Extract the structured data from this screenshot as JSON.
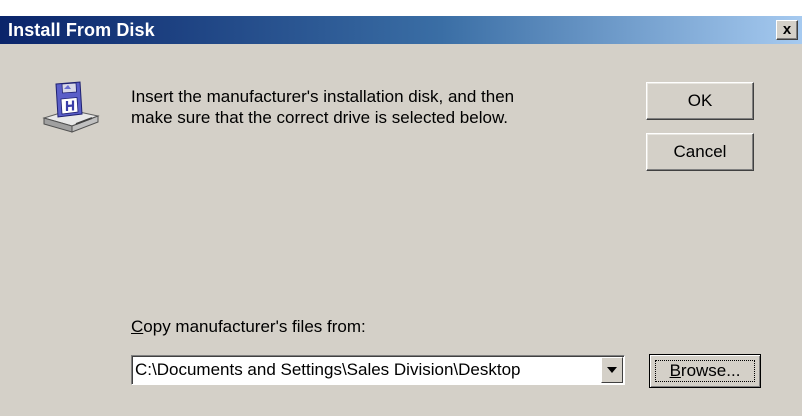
{
  "window": {
    "title": "Install From Disk",
    "close_glyph": "x"
  },
  "message": {
    "line1": "Insert the manufacturer's installation disk, and then",
    "line2": "make sure that the correct drive is selected below."
  },
  "buttons": {
    "ok_label": "OK",
    "cancel_label": "Cancel",
    "browse_prefix": "B",
    "browse_rest": "rowse..."
  },
  "copy_from": {
    "label_prefix": "C",
    "label_rest": "opy manufacturer's files from:",
    "value": "C:\\Documents and Settings\\Sales Division\\Desktop"
  },
  "icons": {
    "disk": "install-disk-icon",
    "dropdown": "chevron-down-icon"
  },
  "colors": {
    "titlebar_start": "#0a246a",
    "titlebar_end": "#a6caf0",
    "dialog_bg": "#d4d0c8"
  }
}
